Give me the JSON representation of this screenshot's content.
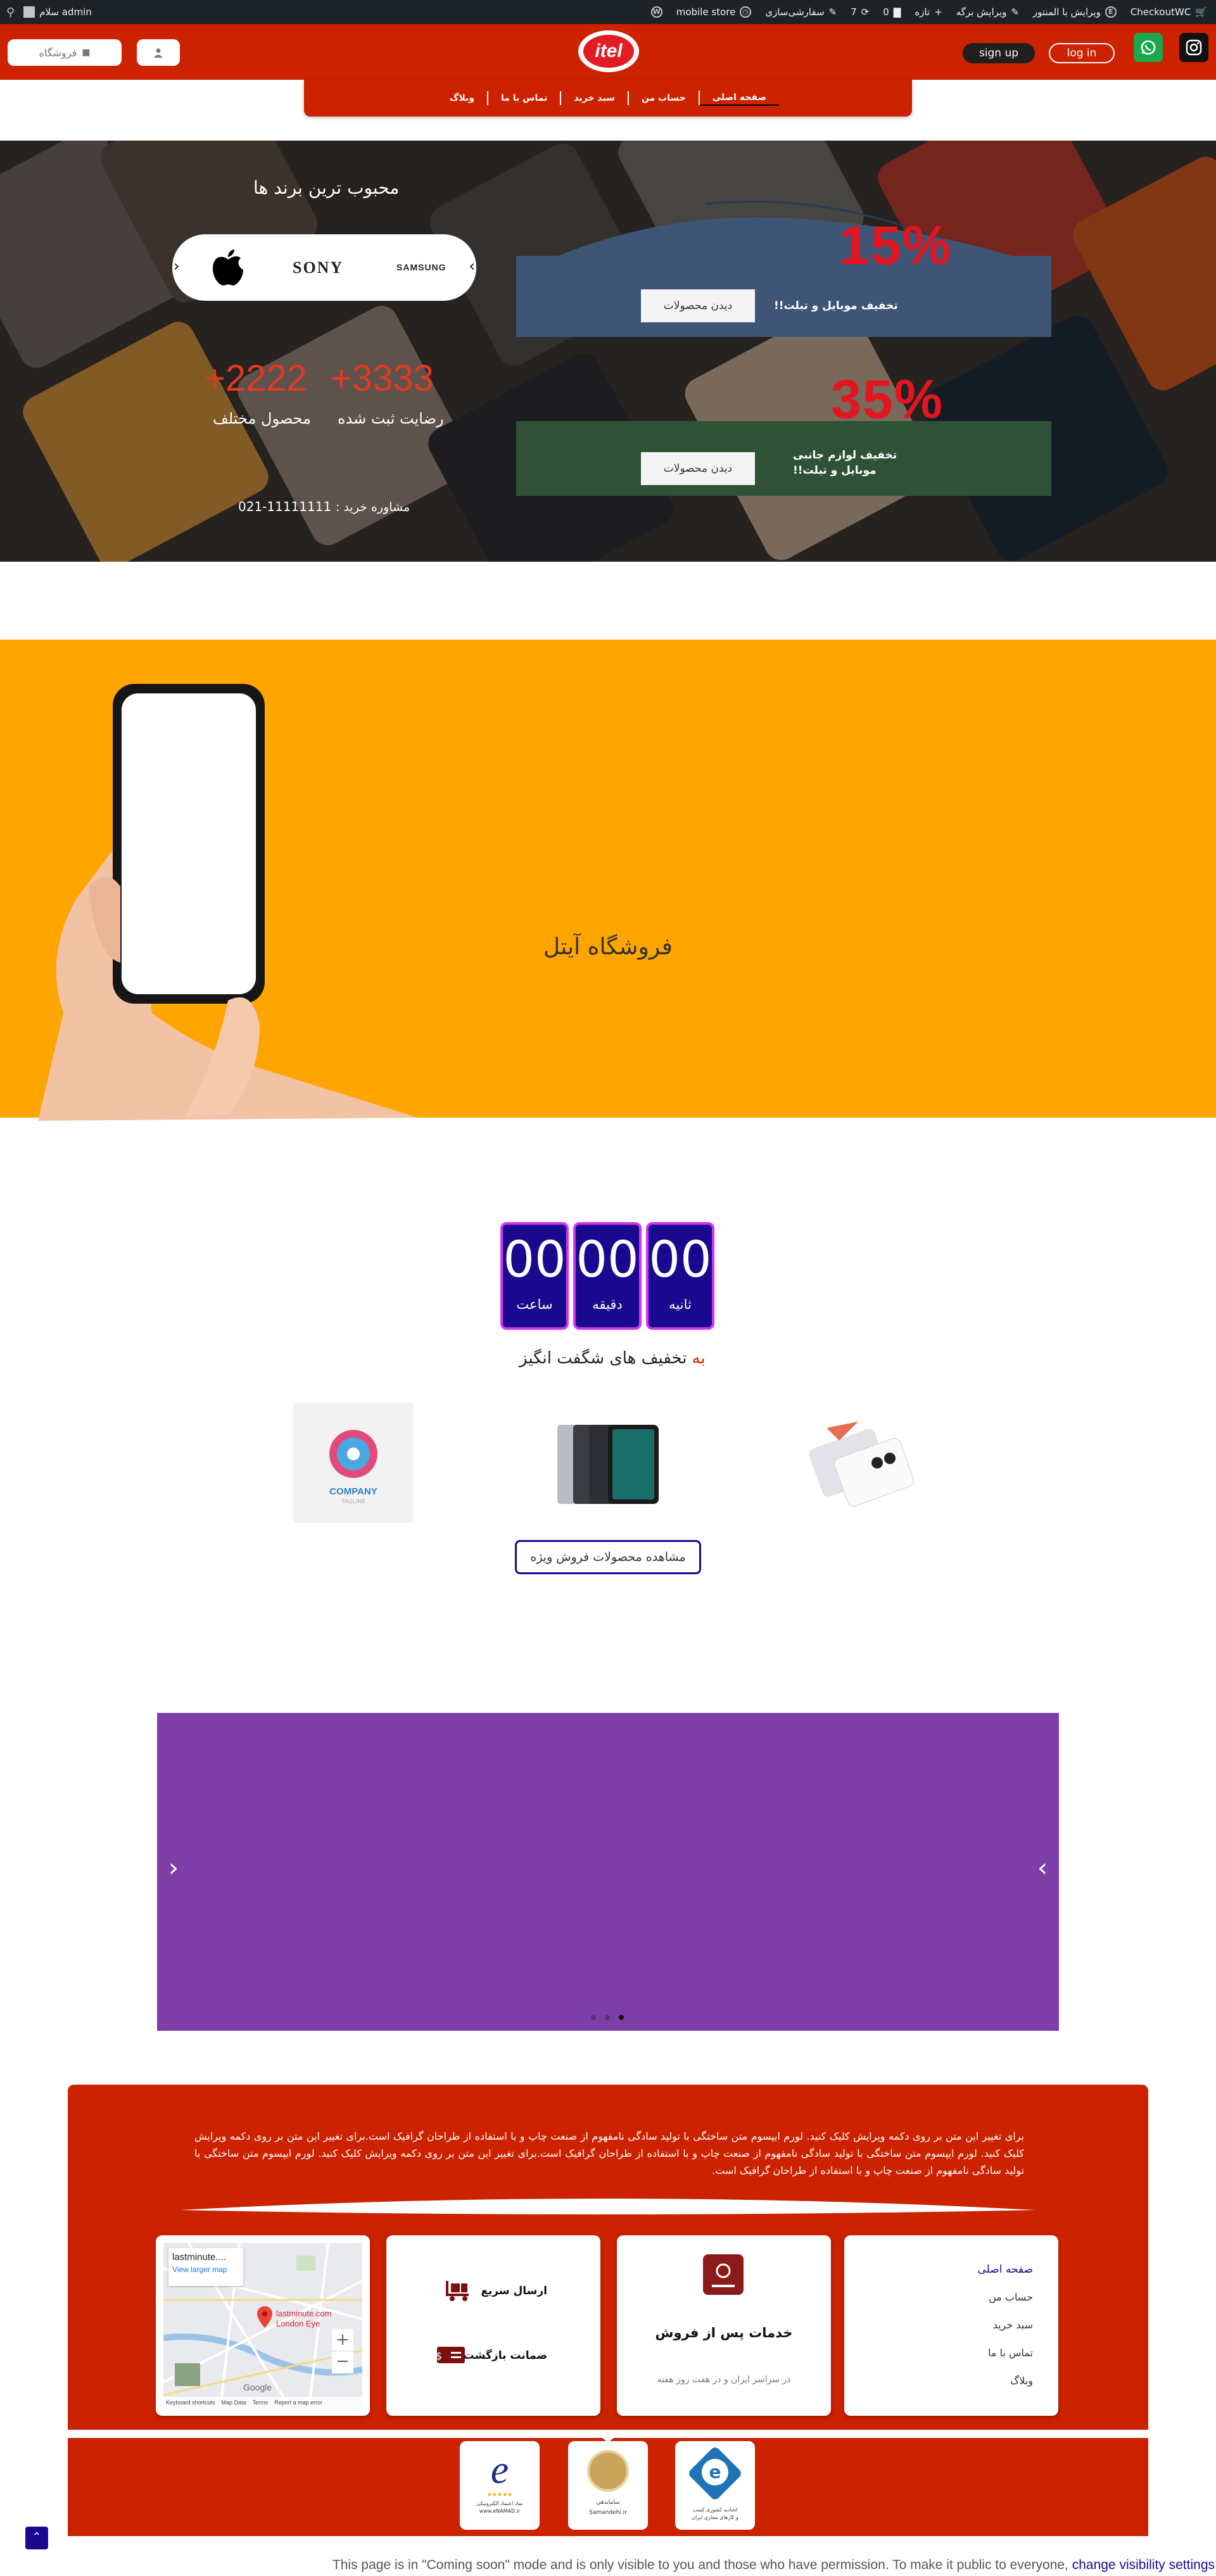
{
  "admin_bar": {
    "greeting": "سلام admin",
    "site_name": "mobile store",
    "customize": "سفارشی‌سازی",
    "updates_count": "7",
    "comments_count": "0",
    "new_label": "تازه",
    "edit_page": "ویرایش برگه",
    "edit_elementor": "ویرایش با المنتور",
    "checkout": "CheckoutWC"
  },
  "header": {
    "shop_label": "فروشگاه",
    "signup": "sign up",
    "login": "log in",
    "logo_text": "itel",
    "brand_color": "#cc2200"
  },
  "nav": {
    "items": [
      {
        "label": "صفحه اصلی"
      },
      {
        "label": "حساب من"
      },
      {
        "label": "سبد خرید"
      },
      {
        "label": "تماس با ما"
      },
      {
        "label": "وبلاگ"
      }
    ]
  },
  "hero": {
    "brands_title": "محبوب ترین برند ها",
    "brands": [
      "SONY",
      "SAMSUNG"
    ],
    "promo1": {
      "percent": "15%",
      "text": "تخفیف موبایل و تبلت!!",
      "button": "دیدن محصولات"
    },
    "promo2": {
      "percent": "35%",
      "text_line1": "تخفیف لوازم جانبی",
      "text_line2": "موبایل و تبلت!!",
      "button": "دیدن محصولات"
    },
    "stat1": {
      "value": "+3333",
      "label": "رضایت ثبت شده"
    },
    "stat2": {
      "value": "+2222",
      "label": "محصول مختلف"
    },
    "consult_label": "مشاوره خرید :",
    "consult_phone": "021-11111111"
  },
  "store_banner": {
    "title": "فروشگاه آیتل"
  },
  "countdown": {
    "units": [
      {
        "value": "00",
        "label": "ساعت"
      },
      {
        "value": "00",
        "label": "دقیقه"
      },
      {
        "value": "00",
        "label": "ثانیه"
      }
    ],
    "title": "تخفیف های شگفت انگیز",
    "title_accent": "به",
    "view_button": "مشاهده محصولات فروش ویژه",
    "company_logo_text": "COMPANY",
    "company_logo_tagline": "TAGLINE"
  },
  "slider": {
    "dots": 3,
    "active_dot": 3
  },
  "footer": {
    "paragraph": "برای تغییر این متن بر روی دکمه ویرایش کلیک کنید. لورم ایپسوم متن ساختگی با تولید سادگی نامفهوم از صنعت چاپ و با استفاده از طراحان گرافیک است.برای تغییر این متن بر روی دکمه ویرایش کلیک کنید. لورم ایپسوم متن ساختگی با تولید سادگی نامفهوم از صنعت چاپ و با استفاده از طراحان گرافیک است.برای تغییر این متن بر روی دکمه ویرایش کلیک کنید. لورم ایپسوم متن ساختگی با تولید سادگی نامفهوم از صنعت چاپ و با استفاده از طراحان گرافیک است.",
    "links": [
      "صفحه اصلی",
      "حساب من",
      "سبد خرید",
      "تماس با ما",
      "وبلاگ"
    ],
    "service_title": "خدمات پس از فروش",
    "service_sub": "در سراسر ایران و در هفت روز هفته",
    "feature1": "ارسال سریع",
    "feature2": "ضمانت بازگشت",
    "map": {
      "place": "lastminute....",
      "larger": "View larger map",
      "pin_label1": "lastminute.com",
      "pin_label2": "London Eye",
      "map_data": "Map Data",
      "terms": "Terms",
      "report": "Report a map error",
      "keyboard": "Keyboard shortcuts",
      "google": "Google"
    },
    "badges": {
      "enamad": "نماد اعتماد الکترونیکی",
      "enamad_site": "www.eNAMAD.ir",
      "samandehi": "Samandehi.ir",
      "samandehi_fa": "ساماندهی",
      "union_line1": "اتحادیه کشوری کسب",
      "union_line2": "و کارهای مجازی ایران"
    }
  },
  "notice": {
    "text": "This page is in \"Coming soon\" mode and is only visible to you and those who have permission. To make it public to everyone,",
    "link": "change visibility settings"
  }
}
